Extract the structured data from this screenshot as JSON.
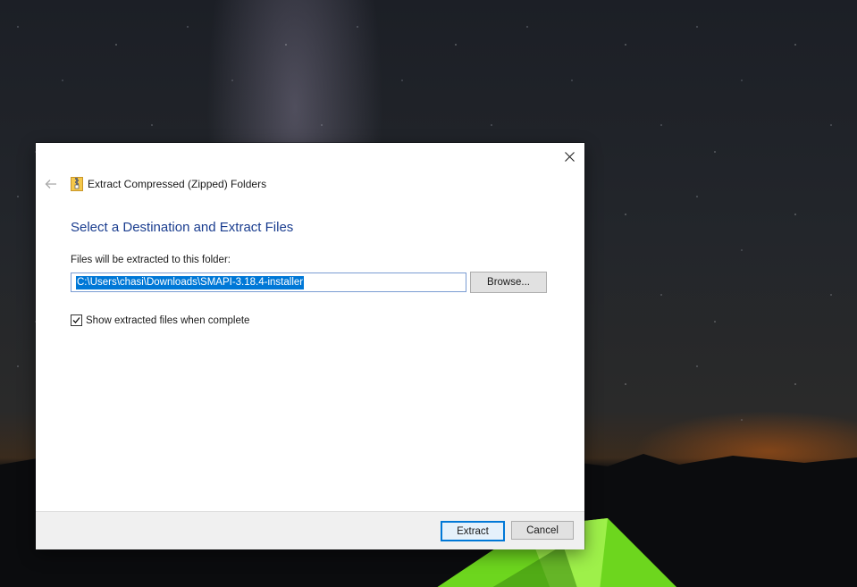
{
  "dialog": {
    "title": "Extract Compressed (Zipped) Folders",
    "heading": "Select a Destination and Extract Files",
    "destination_label": "Files will be extracted to this folder:",
    "destination_path": "C:\\Users\\chasi\\Downloads\\SMAPI-3.18.4-installer",
    "browse_label": "Browse...",
    "show_files_label": "Show extracted files when complete",
    "show_files_checked": true,
    "extract_label": "Extract",
    "cancel_label": "Cancel"
  },
  "icons": {
    "close": "close-icon",
    "back": "back-arrow-icon",
    "zip": "zip-folder-icon",
    "check": "checkmark-icon"
  },
  "colors": {
    "heading": "#1a3d8f",
    "selection": "#0078d7",
    "default_button_border": "#0078d7",
    "footer_bg": "#f0f0f0"
  }
}
